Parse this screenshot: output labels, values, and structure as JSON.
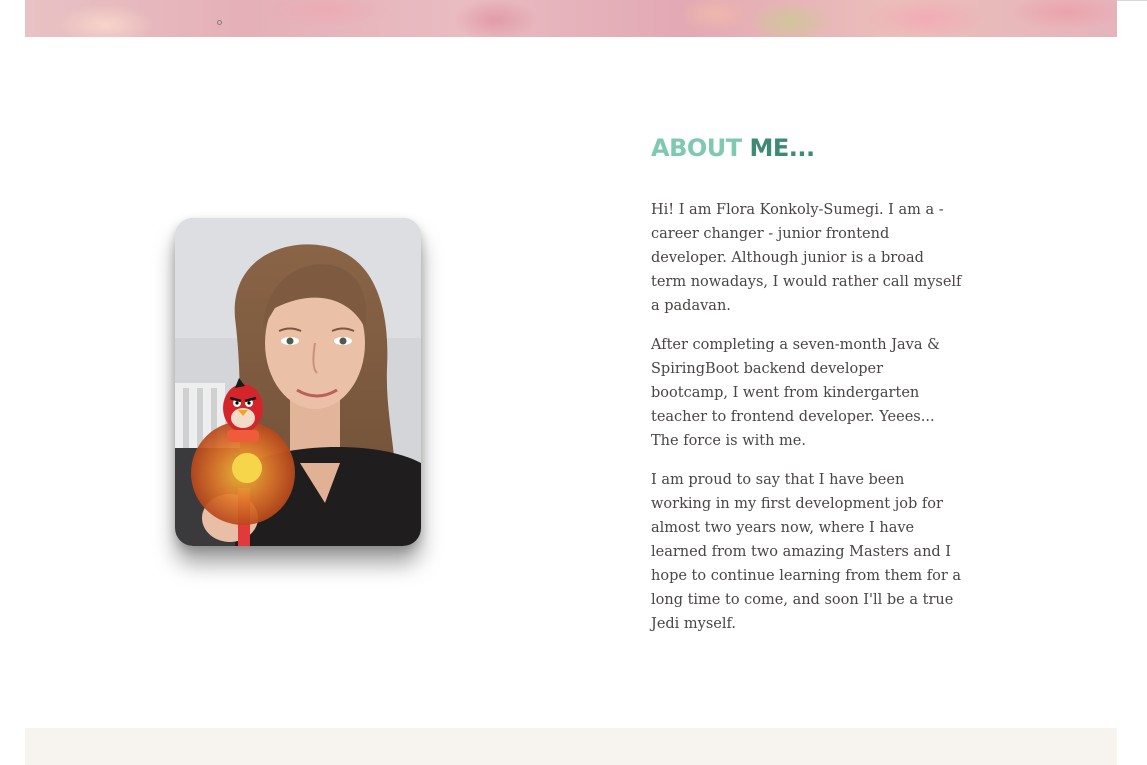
{
  "banner": {
    "image": "pink-flowers-banner"
  },
  "about": {
    "heading_part1": "ABOUT",
    "heading_part2": "ME...",
    "paragraphs": [
      "Hi! I am Flora Konkoly-Sumegi. I am a - career changer - junior frontend developer. Although junior is a broad term nowadays, I would rather call myself a padavan.",
      "After completing a seven-month Java & SpiringBoot backend developer bootcamp, I went from kindergarten teacher to frontend developer. Yeees... The force is with me.",
      "I am proud to say that I have been working in my first development job for almost two years now, where I have learned from two amazing Masters and I hope to continue learning from them for a long time to come, and soon I'll be a true Jedi myself."
    ]
  },
  "photo": {
    "subject": "portrait-photo-with-angry-bird-toy"
  },
  "colors": {
    "heading_light": "#7fc9b0",
    "heading_dark": "#3d8a75",
    "body_text": "#4a4444",
    "footer_band": "#f7f4ef"
  }
}
